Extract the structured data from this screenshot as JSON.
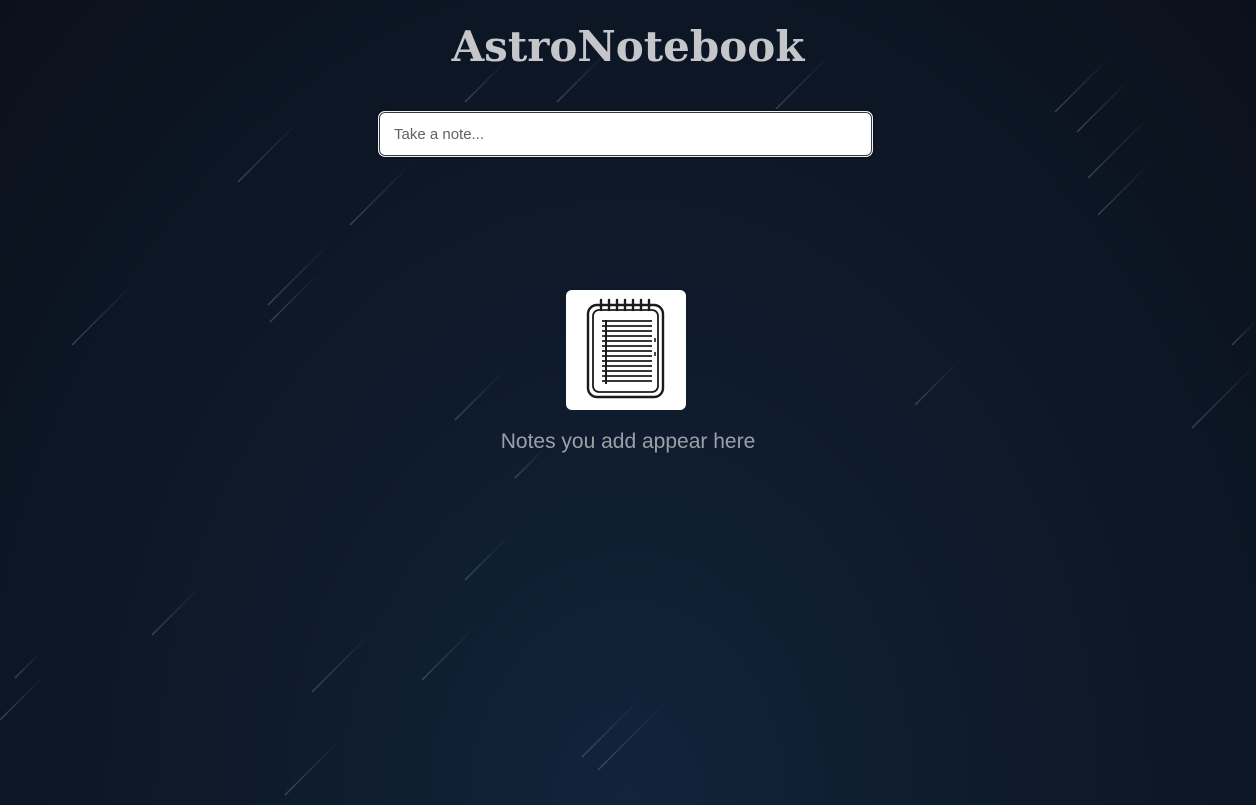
{
  "app": {
    "title": "AstroNotebook"
  },
  "note_input": {
    "placeholder": "Take a note..."
  },
  "empty_state": {
    "icon": "notepad-icon",
    "message": "Notes you add appear here"
  },
  "colors": {
    "background_top": "#0b111c",
    "background_bottom": "#13233a",
    "title": "#c4c6ca",
    "message": "#9aa0a6",
    "input_bg": "#ffffff"
  }
}
